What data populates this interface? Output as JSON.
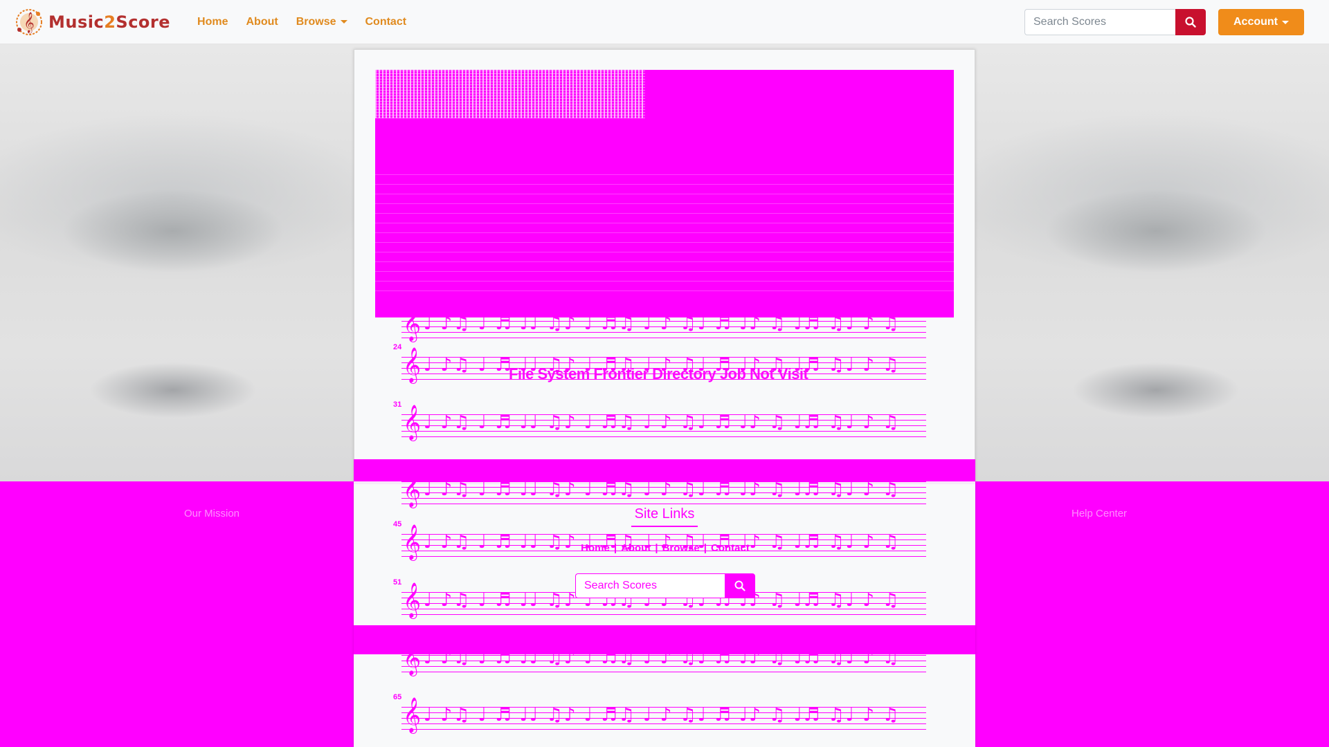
{
  "navbar": {
    "brand_prefix": "Music",
    "brand_two": "2",
    "brand_suffix": "Score",
    "links": [
      "Home",
      "About",
      "Browse",
      "Contact"
    ],
    "search_placeholder": "Search Scores",
    "account_label": "Account"
  },
  "score": {
    "measure_numbers": [
      "24",
      "31",
      "45",
      "51",
      "65"
    ],
    "notes_pattern": "♩ ♪♫ ♩ ♬ ♩♩ ♫♪ ♩ ♬♫ ♩ ♪ ♫♩ ♬ ♩♪ ♫ ♩♬ ♫♩ ♪ ♫ ♩ ♬",
    "overlay_title": "File System Frontier Directory Job Not Visit"
  },
  "footer": {
    "title": "Site Links",
    "links": [
      "Home",
      "|",
      "About",
      "|",
      "Browse",
      "|",
      "Contact"
    ],
    "search_placeholder": "Search Scores",
    "left_heading": "Our Mission",
    "right_heading": "Help Center"
  },
  "colors": {
    "brand_red": "#b3302f",
    "brand_orange": "#e67e22",
    "nav_link": "#e08a1e",
    "search_button": "#c8102e",
    "account_button": "#f08c1a",
    "overlay": "#ff00ff"
  },
  "icons": {
    "logo": "treble-clef-logo-icon",
    "search": "search-icon",
    "footer_search": "search-icon",
    "dropdown": "chevron-down-icon"
  }
}
